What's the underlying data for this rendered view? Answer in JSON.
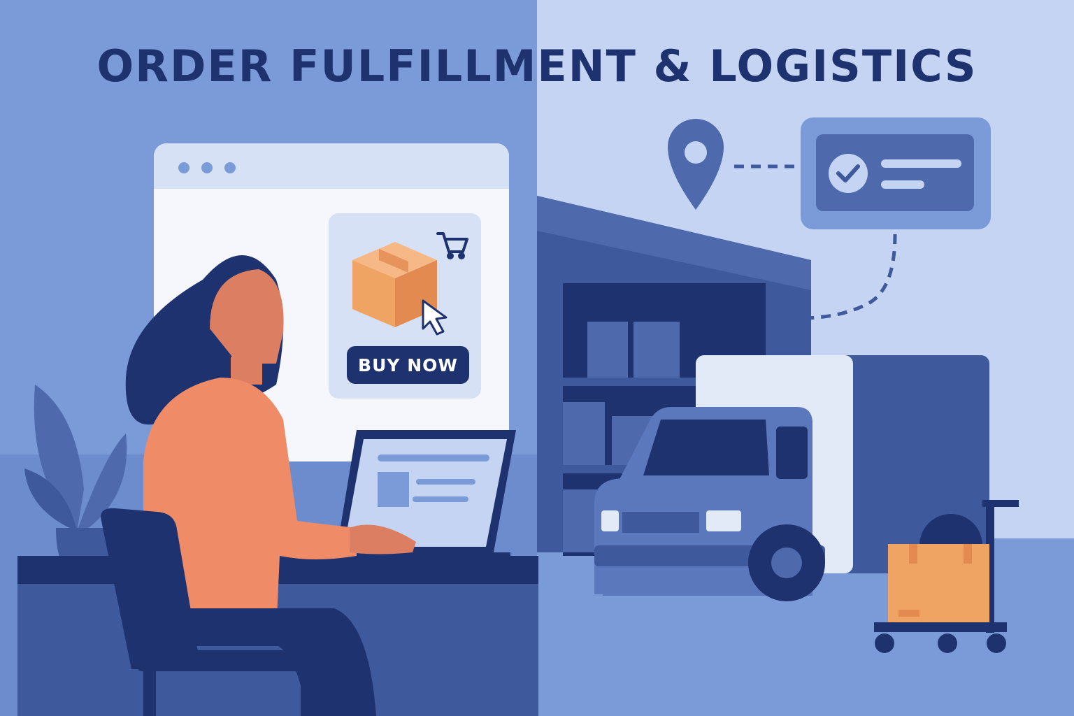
{
  "title": "ORDER FULFILLMENT & LOGISTICS",
  "product_card": {
    "buy_button_label": "BUY NOW",
    "icons": [
      "package-icon",
      "cart-icon",
      "cursor-icon"
    ]
  },
  "tracking": {
    "icons": [
      "location-pin-icon",
      "checkmark-icon"
    ]
  },
  "palette": {
    "left_background": "#7b9bd8",
    "right_background": "#c4d4f2",
    "navy": "#1f3270",
    "box_orange": "#f0a463",
    "shirt_coral": "#f08b67",
    "warehouse_blue": "#3f5a9c"
  }
}
